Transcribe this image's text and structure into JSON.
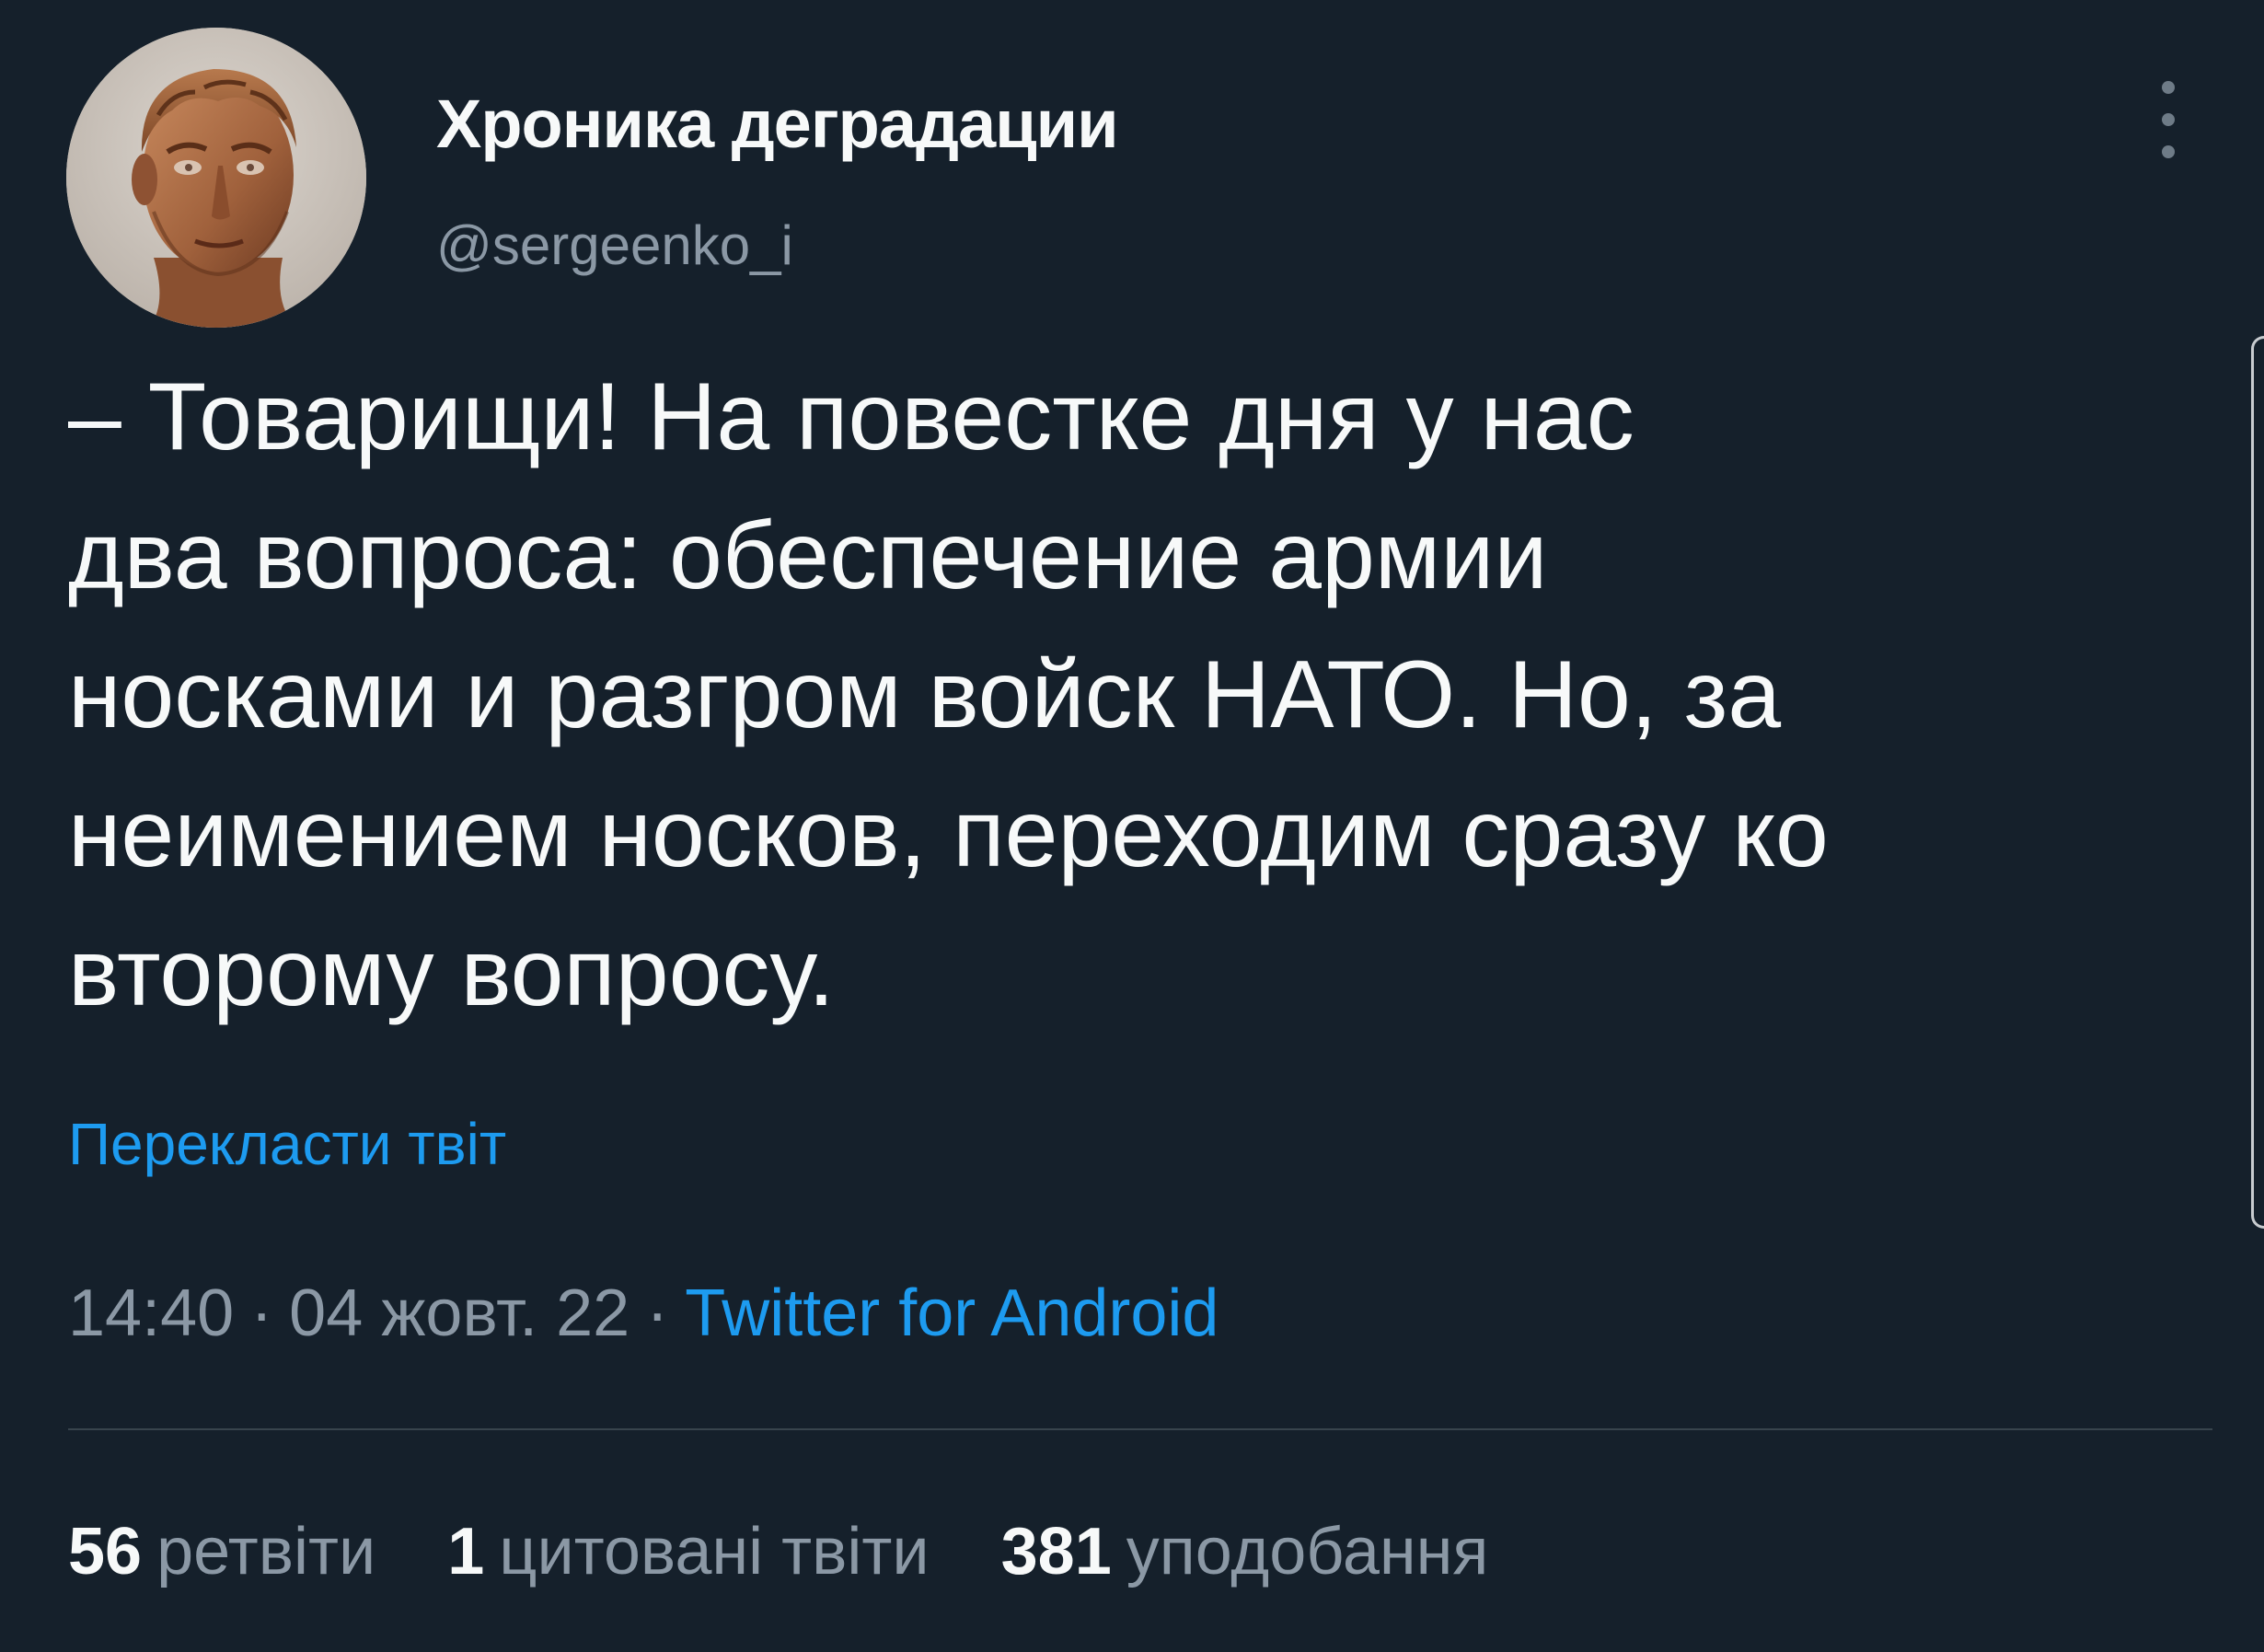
{
  "author": {
    "display_name": "Хроника деградации",
    "handle": "@sergeenko_i",
    "avatar_icon": "bust-portrait-avatar"
  },
  "tweet": {
    "text_lines": [
      "– Товарищи! На повестке дня у нас",
      "два вопроса: обеспечение армии",
      "носками и разгром войск НАТО. Но, за",
      "неимением носков, переходим сразу ко",
      "второму вопросу."
    ],
    "translate_label": "Перекласти твіт",
    "time": "14:40",
    "separator": "·",
    "date": "04 жовт. 22",
    "source": "Twitter for Android"
  },
  "stats": {
    "retweets": {
      "count": "56",
      "label": "ретвіти"
    },
    "quotes": {
      "count": "1",
      "label": "цитовані твіти"
    },
    "likes": {
      "count": "381",
      "label": "уподобання"
    }
  },
  "colors": {
    "background": "#15202b",
    "accent": "#1d9bf0",
    "secondary_text": "#8b98a5",
    "primary_text": "#f7f9f9"
  }
}
